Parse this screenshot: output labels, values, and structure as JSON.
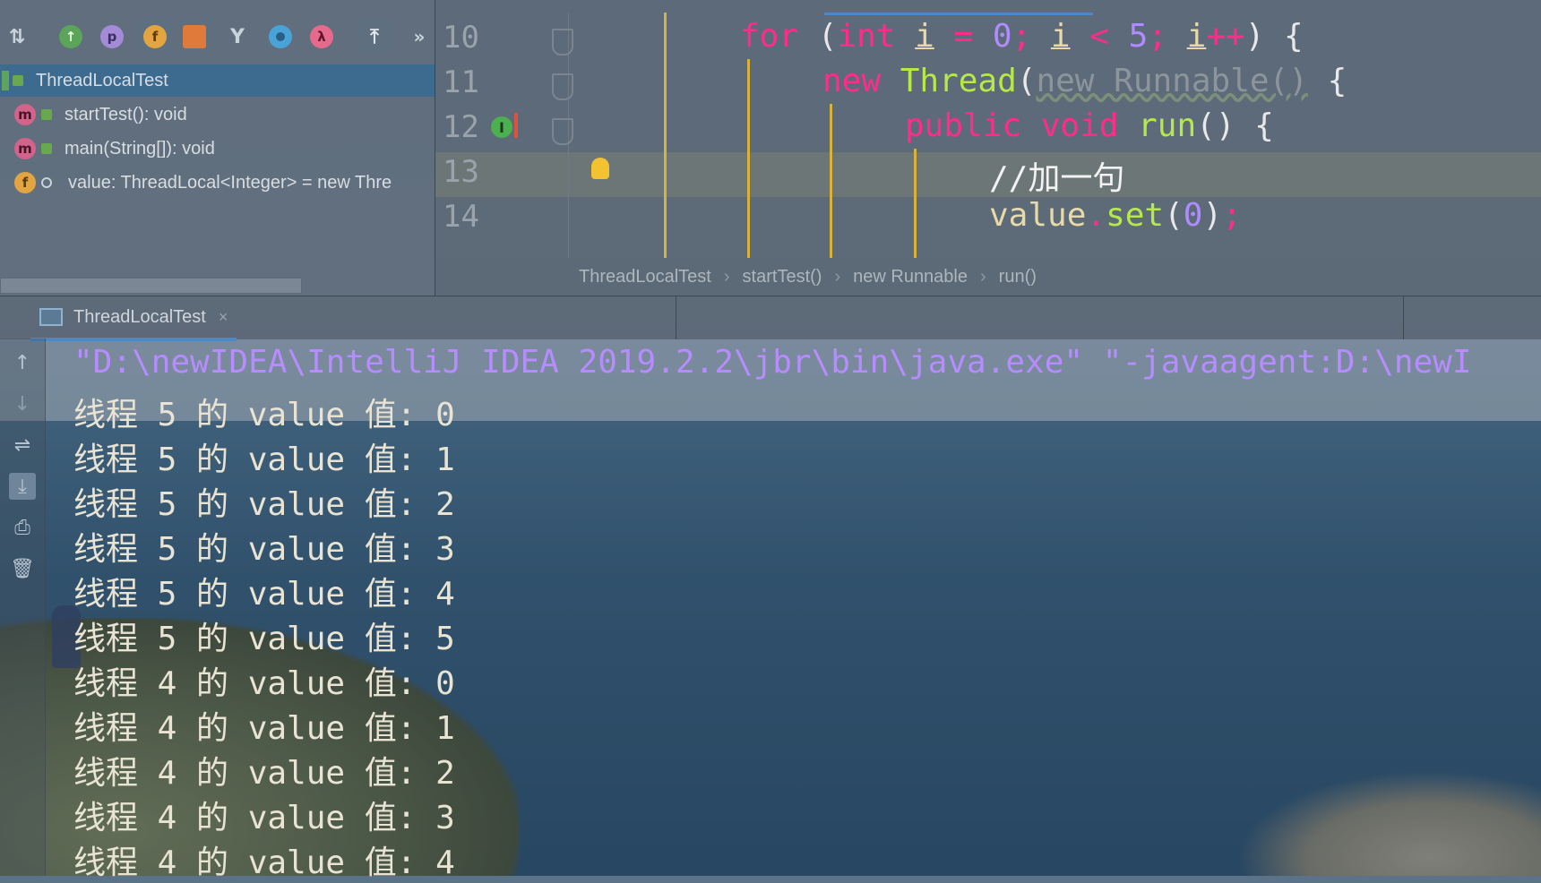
{
  "structure": {
    "toolbar_icons": [
      "sort-alpha-icon",
      "sort-visibility-icon",
      "show-properties-icon",
      "show-fields-icon",
      "show-non-public-icon",
      "show-inherited-icon",
      "anonymous-classes-icon",
      "lambdas-icon",
      "autoscroll-icon",
      "more-icon"
    ],
    "toolbar_labels": {
      "p": "p",
      "f": "f",
      "lambda": "λ",
      "more": "»"
    },
    "items": [
      {
        "kind": "class",
        "label": "ThreadLocalTest"
      },
      {
        "kind": "method",
        "badge": "m",
        "label": "startTest(): void"
      },
      {
        "kind": "method",
        "badge": "m",
        "label": "main(String[]): void"
      },
      {
        "kind": "field",
        "badge": "f",
        "label": "value: ThreadLocal<Integer> = new Thre"
      }
    ]
  },
  "editor": {
    "lines": [
      {
        "num": "10"
      },
      {
        "num": "11"
      },
      {
        "num": "12"
      },
      {
        "num": "13"
      },
      {
        "num": "14"
      }
    ],
    "code": {
      "l10": {
        "for": "for",
        "open": " (",
        "int": "int",
        "i1": "i",
        "eq": " = ",
        "zero": "0",
        "semi1": "; ",
        "i2": "i",
        "lt": " < ",
        "five": "5",
        "semi2": "; ",
        "i3": "i",
        "pp": "++",
        "close": ") {"
      },
      "l11": {
        "new": "new",
        "thread": "Thread",
        "paren": "(",
        "runnable": "new Runnable()",
        "brace": " {"
      },
      "l12": {
        "public": "public",
        "void": "void",
        "run": "run",
        "rest": "() {"
      },
      "l13": {
        "comment": "//加一句"
      },
      "l14": {
        "value": "value",
        "dot": ".",
        "set": "set",
        "p1": "(",
        "zero": "0",
        "p2": ")",
        "semi": ";"
      }
    },
    "gutter_marker": "I"
  },
  "breadcrumbs": [
    "ThreadLocalTest",
    "startTest()",
    "new Runnable",
    "run()"
  ],
  "breadcrumb_sep": "›",
  "run": {
    "tab_label": "ThreadLocalTest",
    "close_glyph": "×",
    "command": "\"D:\\newIDEA\\IntelliJ IDEA 2019.2.2\\jbr\\bin\\java.exe\" \"-javaagent:D:\\newI",
    "output": [
      "线程 5 的 value 值: 0",
      "线程 5 的 value 值: 1",
      "线程 5 的 value 值: 2",
      "线程 5 的 value 值: 3",
      "线程 5 的 value 值: 4",
      "线程 5 的 value 值: 5",
      "线程 4 的 value 值: 0",
      "线程 4 的 value 值: 1",
      "线程 4 的 value 值: 2",
      "线程 4 的 value 值: 3",
      "线程 4 的 value 值: 4"
    ],
    "side_icons": [
      "up-arrow-icon",
      "down-arrow-icon",
      "soft-wrap-icon",
      "scroll-to-end-icon",
      "print-icon",
      "trash-icon"
    ]
  },
  "colors": {
    "keyword": "#ff2d8a",
    "type": "#b7e84a",
    "number": "#b18cff",
    "accent": "#4a88c7"
  }
}
